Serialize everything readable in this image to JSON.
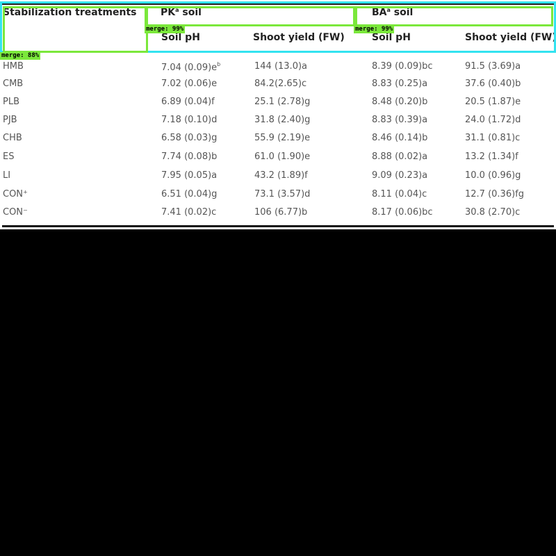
{
  "table": {
    "header": {
      "treatments": "Stabilization treatments",
      "pk_label": "PK",
      "pk_sup": "a",
      "pk_suffix": " soil",
      "ba_label": "BA",
      "ba_sup": "a",
      "ba_suffix": " soil",
      "pk_ph": "Soil pH",
      "pk_yield": "Shoot yield (FW)",
      "ba_ph": "Soil pH",
      "ba_yield": "Shoot yield (FW)"
    },
    "rows": [
      {
        "name": "HMB",
        "pk_ph": "7.04 (0.09)e",
        "pk_ph_sup": "b",
        "pk_yield": "144 (13.0)a",
        "ba_ph": "8.39 (0.09)bc",
        "ba_yield": "91.5 (3.69)a"
      },
      {
        "name": "CMB",
        "pk_ph": "7.02 (0.06)e",
        "pk_ph_sup": "",
        "pk_yield": "84.2(2.65)c",
        "ba_ph": "8.83 (0.25)a",
        "ba_yield": "37.6 (0.40)b"
      },
      {
        "name": "PLB",
        "pk_ph": "6.89 (0.04)f",
        "pk_ph_sup": "",
        "pk_yield": "25.1 (2.78)g",
        "ba_ph": "8.48 (0.20)b",
        "ba_yield": "20.5 (1.87)e"
      },
      {
        "name": "PJB",
        "pk_ph": "7.18 (0.10)d",
        "pk_ph_sup": "",
        "pk_yield": "31.8 (2.40)g",
        "ba_ph": "8.83 (0.39)a",
        "ba_yield": "24.0 (1.72)d"
      },
      {
        "name": "CHB",
        "pk_ph": "6.58 (0.03)g",
        "pk_ph_sup": "",
        "pk_yield": "55.9 (2.19)e",
        "ba_ph": "8.46 (0.14)b",
        "ba_yield": "31.1 (0.81)c"
      },
      {
        "name": "ES",
        "pk_ph": "7.74 (0.08)b",
        "pk_ph_sup": "",
        "pk_yield": "61.0 (1.90)e",
        "ba_ph": "8.88 (0.02)a",
        "ba_yield": "13.2 (1.34)f"
      },
      {
        "name": "LI",
        "pk_ph": "7.95 (0.05)a",
        "pk_ph_sup": "",
        "pk_yield": "43.2 (1.89)f",
        "ba_ph": "9.09 (0.23)a",
        "ba_yield": "10.0 (0.96)g"
      },
      {
        "name": "CON⁺",
        "pk_ph": "6.51 (0.04)g",
        "pk_ph_sup": "",
        "pk_yield": "73.1 (3.57)d",
        "ba_ph": "8.11 (0.04)c",
        "ba_yield": "12.7 (0.36)fg"
      },
      {
        "name": "CON⁻",
        "pk_ph": "7.41 (0.02)c",
        "pk_ph_sup": "",
        "pk_yield": "106 (6.77)b",
        "ba_ph": "8.17 (0.06)bc",
        "ba_yield": "30.8 (2.70)c"
      }
    ]
  },
  "overlay": {
    "tags": {
      "pk": "merge: 99%",
      "ba": "merge: 99%",
      "treat": "merge: 88%"
    }
  }
}
